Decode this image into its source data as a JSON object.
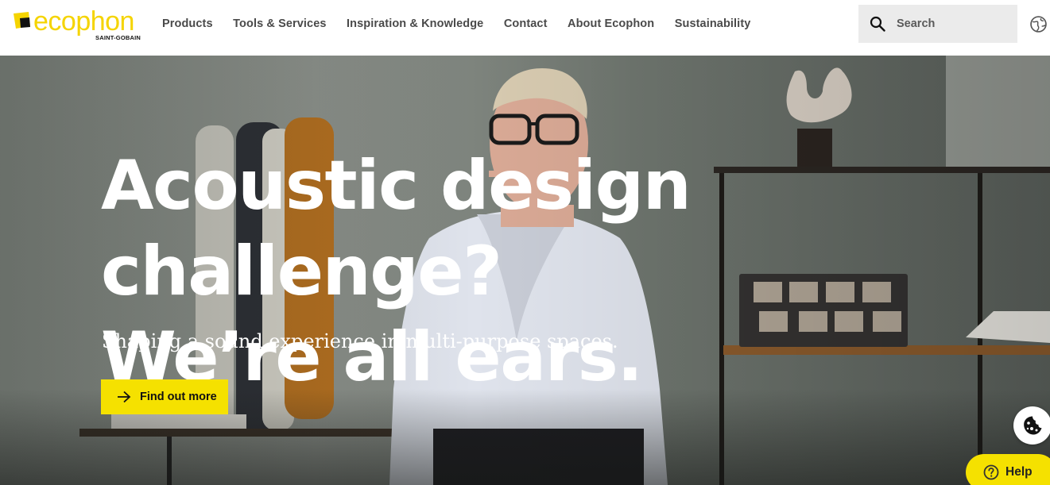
{
  "header": {
    "logo": {
      "wordmark": "ecophon",
      "subline": "SAINT-GOBAIN",
      "brand_color": "#f5d400"
    },
    "nav": [
      {
        "label": "Products"
      },
      {
        "label": "Tools & Services"
      },
      {
        "label": "Inspiration & Knowledge"
      },
      {
        "label": "Contact"
      },
      {
        "label": "About Ecophon"
      },
      {
        "label": "Sustainability"
      }
    ],
    "search": {
      "placeholder": "Search",
      "icon": "search-icon"
    },
    "language_icon": "globe-icon"
  },
  "hero": {
    "headline_line1": "Acoustic design challenge?",
    "headline_line2": "We’re all ears.",
    "tagline": "Shaping a sound experience in multi-purpose spaces.",
    "cta": {
      "label": "Find out more",
      "icon": "arrow-right-icon",
      "color": "#f5e100"
    }
  },
  "widgets": {
    "cookie_icon": "cookie-icon",
    "help": {
      "label": "Help",
      "icon": "question-circle-icon",
      "color": "#f5e100"
    }
  }
}
